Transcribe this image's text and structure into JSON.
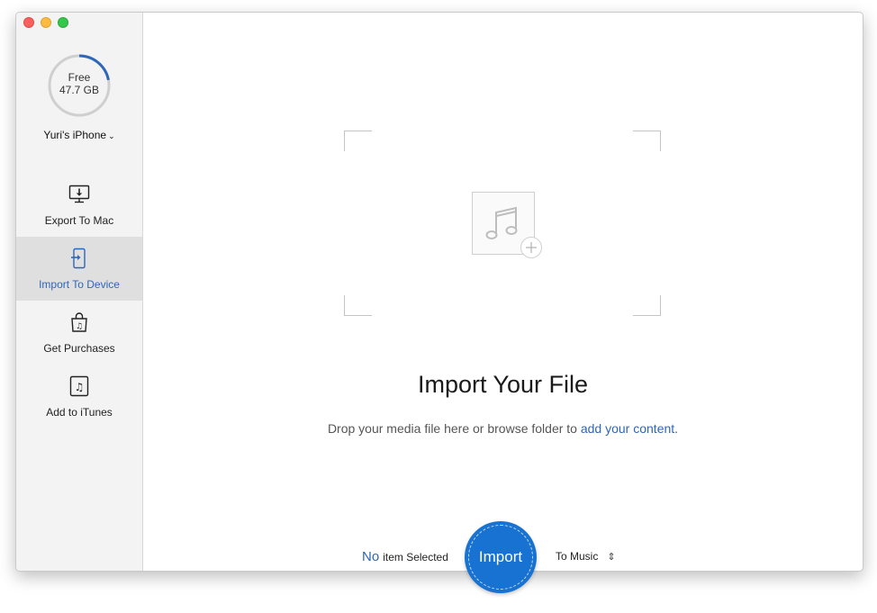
{
  "window": {
    "traffic_lights": [
      "close",
      "minimize",
      "maximize"
    ]
  },
  "sidebar": {
    "storage": {
      "label": "Free",
      "value": "47.7 GB",
      "used_fraction": 0.22,
      "accent": "#2e66b8"
    },
    "device_name": "Yuri's iPhone",
    "items": [
      {
        "label": "Export To Mac",
        "icon": "monitor-download-icon",
        "active": false
      },
      {
        "label": "Import To Device",
        "icon": "import-arrow-icon",
        "active": true
      },
      {
        "label": "Get Purchases",
        "icon": "shopping-bag-icon",
        "active": false
      },
      {
        "label": "Add to iTunes",
        "icon": "music-note-icon",
        "active": false
      }
    ]
  },
  "main": {
    "title": "Import Your File",
    "subtitle_prefix": "Drop your media file here or browse folder to ",
    "subtitle_link": "add your content",
    "subtitle_suffix": ".",
    "status_count": "No",
    "status_text": "item Selected",
    "import_label": "Import",
    "destination": "To Music"
  },
  "colors": {
    "accent": "#2e66b8",
    "import_button": "#1872d1",
    "sidebar_bg": "#f3f3f3",
    "active_bg": "#dfdfdf"
  }
}
